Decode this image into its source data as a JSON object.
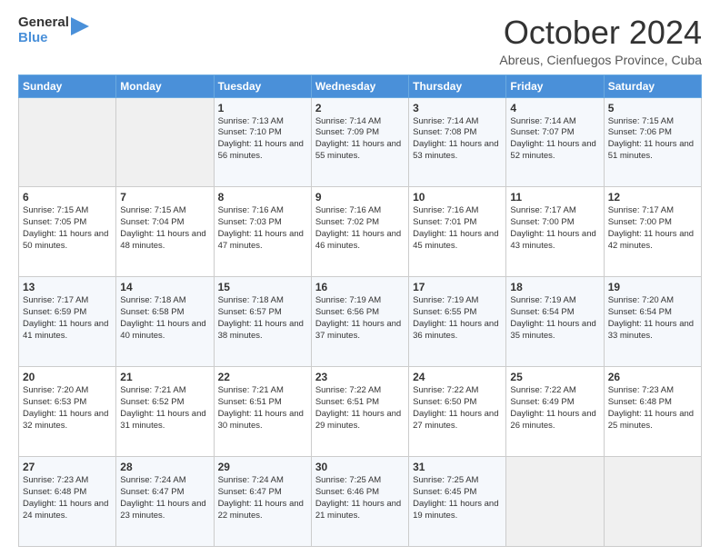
{
  "logo": {
    "general": "General",
    "blue": "Blue"
  },
  "header": {
    "month": "October 2024",
    "location": "Abreus, Cienfuegos Province, Cuba"
  },
  "weekdays": [
    "Sunday",
    "Monday",
    "Tuesday",
    "Wednesday",
    "Thursday",
    "Friday",
    "Saturday"
  ],
  "weeks": [
    [
      {
        "day": "",
        "info": ""
      },
      {
        "day": "",
        "info": ""
      },
      {
        "day": "1",
        "info": "Sunrise: 7:13 AM\nSunset: 7:10 PM\nDaylight: 11 hours and 56 minutes."
      },
      {
        "day": "2",
        "info": "Sunrise: 7:14 AM\nSunset: 7:09 PM\nDaylight: 11 hours and 55 minutes."
      },
      {
        "day": "3",
        "info": "Sunrise: 7:14 AM\nSunset: 7:08 PM\nDaylight: 11 hours and 53 minutes."
      },
      {
        "day": "4",
        "info": "Sunrise: 7:14 AM\nSunset: 7:07 PM\nDaylight: 11 hours and 52 minutes."
      },
      {
        "day": "5",
        "info": "Sunrise: 7:15 AM\nSunset: 7:06 PM\nDaylight: 11 hours and 51 minutes."
      }
    ],
    [
      {
        "day": "6",
        "info": "Sunrise: 7:15 AM\nSunset: 7:05 PM\nDaylight: 11 hours and 50 minutes."
      },
      {
        "day": "7",
        "info": "Sunrise: 7:15 AM\nSunset: 7:04 PM\nDaylight: 11 hours and 48 minutes."
      },
      {
        "day": "8",
        "info": "Sunrise: 7:16 AM\nSunset: 7:03 PM\nDaylight: 11 hours and 47 minutes."
      },
      {
        "day": "9",
        "info": "Sunrise: 7:16 AM\nSunset: 7:02 PM\nDaylight: 11 hours and 46 minutes."
      },
      {
        "day": "10",
        "info": "Sunrise: 7:16 AM\nSunset: 7:01 PM\nDaylight: 11 hours and 45 minutes."
      },
      {
        "day": "11",
        "info": "Sunrise: 7:17 AM\nSunset: 7:00 PM\nDaylight: 11 hours and 43 minutes."
      },
      {
        "day": "12",
        "info": "Sunrise: 7:17 AM\nSunset: 7:00 PM\nDaylight: 11 hours and 42 minutes."
      }
    ],
    [
      {
        "day": "13",
        "info": "Sunrise: 7:17 AM\nSunset: 6:59 PM\nDaylight: 11 hours and 41 minutes."
      },
      {
        "day": "14",
        "info": "Sunrise: 7:18 AM\nSunset: 6:58 PM\nDaylight: 11 hours and 40 minutes."
      },
      {
        "day": "15",
        "info": "Sunrise: 7:18 AM\nSunset: 6:57 PM\nDaylight: 11 hours and 38 minutes."
      },
      {
        "day": "16",
        "info": "Sunrise: 7:19 AM\nSunset: 6:56 PM\nDaylight: 11 hours and 37 minutes."
      },
      {
        "day": "17",
        "info": "Sunrise: 7:19 AM\nSunset: 6:55 PM\nDaylight: 11 hours and 36 minutes."
      },
      {
        "day": "18",
        "info": "Sunrise: 7:19 AM\nSunset: 6:54 PM\nDaylight: 11 hours and 35 minutes."
      },
      {
        "day": "19",
        "info": "Sunrise: 7:20 AM\nSunset: 6:54 PM\nDaylight: 11 hours and 33 minutes."
      }
    ],
    [
      {
        "day": "20",
        "info": "Sunrise: 7:20 AM\nSunset: 6:53 PM\nDaylight: 11 hours and 32 minutes."
      },
      {
        "day": "21",
        "info": "Sunrise: 7:21 AM\nSunset: 6:52 PM\nDaylight: 11 hours and 31 minutes."
      },
      {
        "day": "22",
        "info": "Sunrise: 7:21 AM\nSunset: 6:51 PM\nDaylight: 11 hours and 30 minutes."
      },
      {
        "day": "23",
        "info": "Sunrise: 7:22 AM\nSunset: 6:51 PM\nDaylight: 11 hours and 29 minutes."
      },
      {
        "day": "24",
        "info": "Sunrise: 7:22 AM\nSunset: 6:50 PM\nDaylight: 11 hours and 27 minutes."
      },
      {
        "day": "25",
        "info": "Sunrise: 7:22 AM\nSunset: 6:49 PM\nDaylight: 11 hours and 26 minutes."
      },
      {
        "day": "26",
        "info": "Sunrise: 7:23 AM\nSunset: 6:48 PM\nDaylight: 11 hours and 25 minutes."
      }
    ],
    [
      {
        "day": "27",
        "info": "Sunrise: 7:23 AM\nSunset: 6:48 PM\nDaylight: 11 hours and 24 minutes."
      },
      {
        "day": "28",
        "info": "Sunrise: 7:24 AM\nSunset: 6:47 PM\nDaylight: 11 hours and 23 minutes."
      },
      {
        "day": "29",
        "info": "Sunrise: 7:24 AM\nSunset: 6:47 PM\nDaylight: 11 hours and 22 minutes."
      },
      {
        "day": "30",
        "info": "Sunrise: 7:25 AM\nSunset: 6:46 PM\nDaylight: 11 hours and 21 minutes."
      },
      {
        "day": "31",
        "info": "Sunrise: 7:25 AM\nSunset: 6:45 PM\nDaylight: 11 hours and 19 minutes."
      },
      {
        "day": "",
        "info": ""
      },
      {
        "day": "",
        "info": ""
      }
    ]
  ]
}
